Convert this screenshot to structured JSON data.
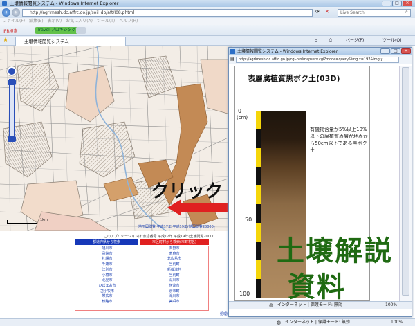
{
  "browser": {
    "window_title": "土壌情報閲覧システム - Windows Internet Explorer",
    "url": "http://agrimesh.dc.affrc.go.jp/soil_db/aft/I08.phtml",
    "search_placeholder": "Live Search",
    "menu_items": [
      "ファイル(F)",
      "編集(E)",
      "表示(V)",
      "お気に入り(A)",
      "ツール(T)",
      "ヘルプ(H)"
    ],
    "toolbar_items": [
      "IPR検索",
      "Travel プロキシタグ"
    ],
    "tab_label": "土壌情報閲覧システム",
    "cmd_page": "ページ(P)",
    "cmd_tools": "ツール(O)",
    "status_zone": "インターネット | 保護モード: 無効",
    "status_zoom": "100%"
  },
  "map": {
    "caption": "地形図閲覧 平成17年 平成19年(地図閲覧20000)",
    "scale_label": "1km"
  },
  "list": {
    "note": "このアプリケーションは 表記番号 平成17年 平成19年(土壌閲覧20000",
    "header_left": "都道府県から検索",
    "header_right": "市区町村から検索(市町村名)",
    "left_items": [
      "旭川市",
      "函館市",
      "札幌市",
      "千歳市",
      "江別市",
      "小樽市",
      "北見市",
      "ひばまお市",
      "苫小牧市",
      "帯広市",
      "釧路市"
    ],
    "right_items": [
      "石狩市",
      "恵庭市",
      "北広島市",
      "当別町",
      "新篠津村",
      "当別町",
      "深川市",
      "伊達市",
      "余市町",
      "滝川市",
      "美唄市"
    ],
    "bottom_note": "処理終"
  },
  "overlay": {
    "click_label": "クリック",
    "explanation_label_1": "土壌解説",
    "explanation_label_2": "資料"
  },
  "popup": {
    "window_title": "土壌情報閲覧システム - Windows Internet Explorer",
    "url": "http://agrimesh.dc.affrc.go.jp/cgi-bin/mapserv.cgi?mode=query&img.x=192&img.y",
    "soil_title": "表層腐植質黒ボク土(03D)",
    "depth_label": "(cm)",
    "depth_ticks": [
      "0",
      "50",
      "100"
    ],
    "description": "有機物含量が5%以上10%以下の腐植質表層が地表から50cm以下である黒ボク土",
    "status_zone": "インターネット | 保護モード: 無効",
    "status_zoom": "100%"
  },
  "colors": {
    "click_arrow": "#e02020",
    "overlay_text_green": "#1f6a12",
    "soil_top": "#1e150c",
    "soil_bottom": "#b08b60",
    "ruler_yellow": "#f5d60a"
  }
}
